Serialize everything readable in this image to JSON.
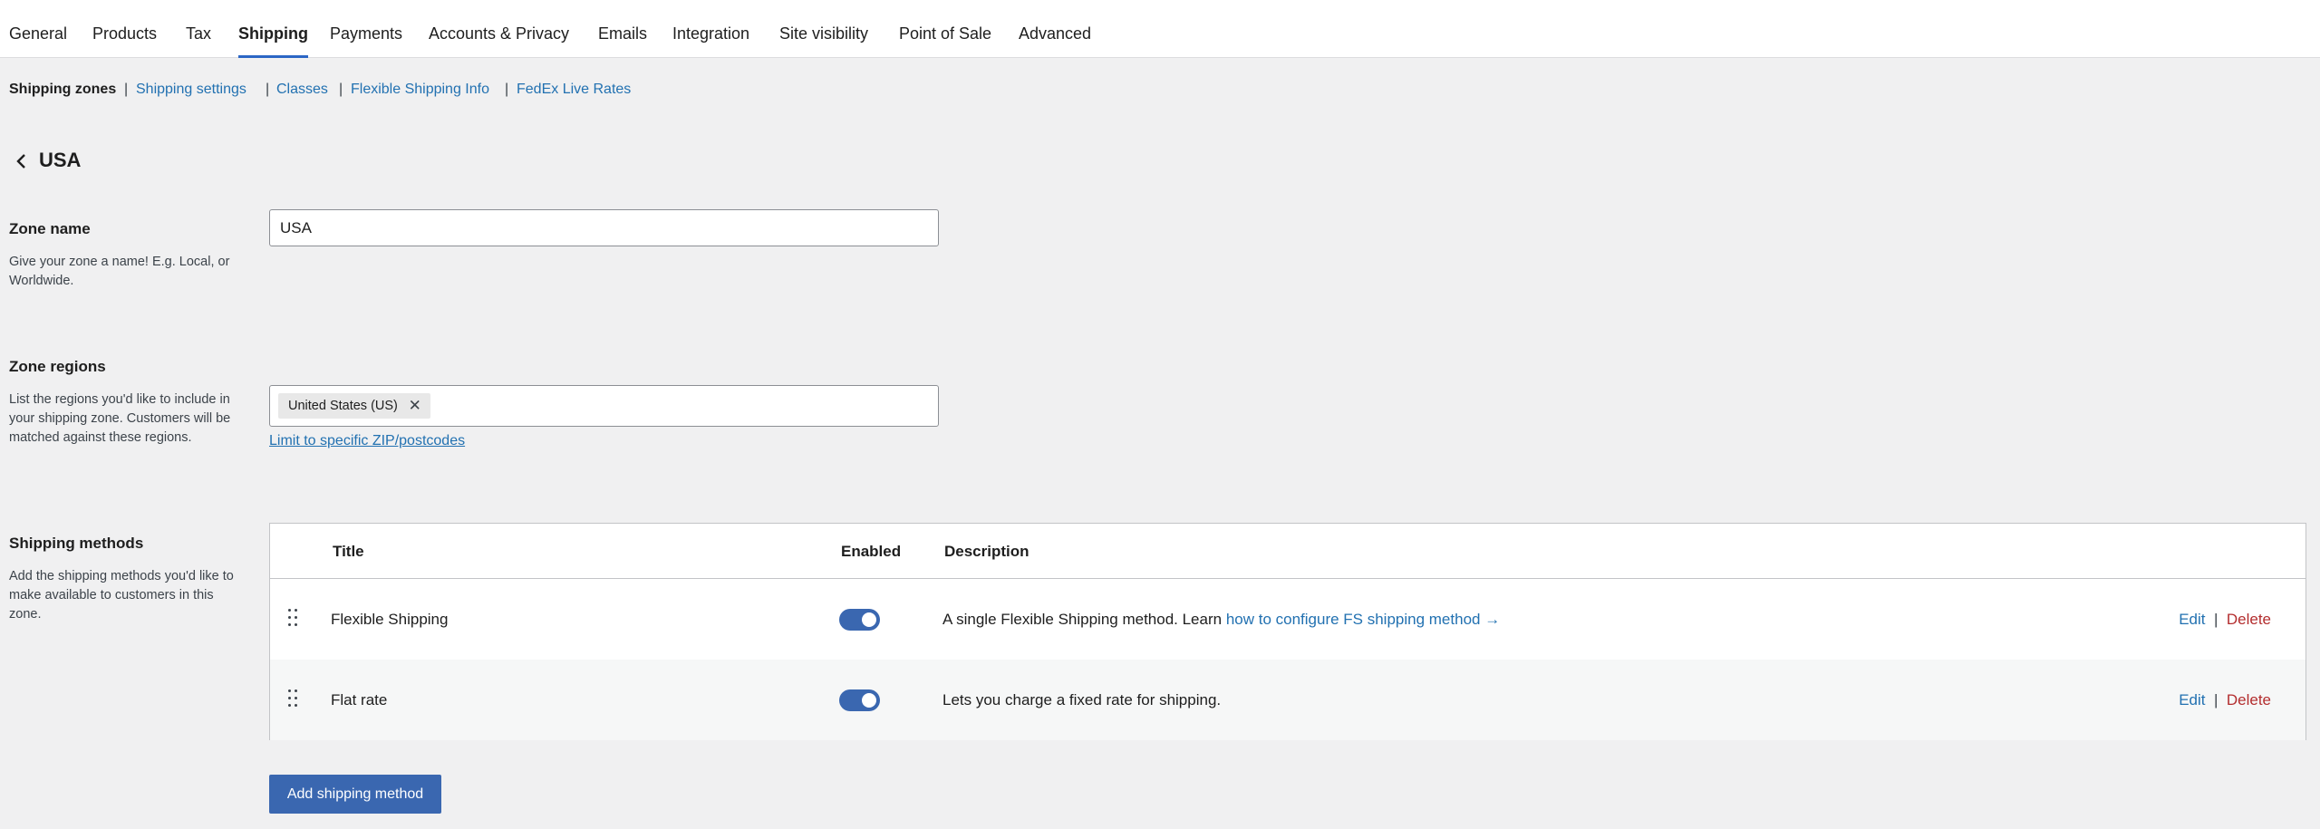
{
  "tabs": [
    {
      "label": "General"
    },
    {
      "label": "Products"
    },
    {
      "label": "Tax"
    },
    {
      "label": "Shipping"
    },
    {
      "label": "Payments"
    },
    {
      "label": "Accounts & Privacy"
    },
    {
      "label": "Emails"
    },
    {
      "label": "Integration"
    },
    {
      "label": "Site visibility"
    },
    {
      "label": "Point of Sale"
    },
    {
      "label": "Advanced"
    }
  ],
  "active_tab": "Shipping",
  "subnav": {
    "current": "Shipping zones",
    "links": [
      "Shipping settings",
      "Classes",
      "Flexible Shipping Info",
      "FedEx Live Rates"
    ],
    "separator": "|"
  },
  "page_title": "USA",
  "zone_name": {
    "title": "Zone name",
    "description": "Give your zone a name! E.g. Local, or Worldwide.",
    "value": "USA"
  },
  "zone_regions": {
    "title": "Zone regions",
    "description": "List the regions you'd like to include in your shipping zone. Customers will be matched against these regions.",
    "chip": "United States (US)",
    "chip_remove": "✕",
    "limit_link": "Limit to specific ZIP/postcodes"
  },
  "shipping_methods": {
    "title": "Shipping methods",
    "description": "Add the shipping methods you'd like to make available to customers in this zone.",
    "columns": {
      "title": "Title",
      "enabled": "Enabled",
      "description": "Description"
    },
    "rows": [
      {
        "title": "Flexible Shipping",
        "enabled": true,
        "description": "A single Flexible Shipping method. Learn ",
        "description_link": "how to configure FS shipping method →",
        "edit": "Edit",
        "delete": "Delete"
      },
      {
        "title": "Flat rate",
        "enabled": true,
        "description": "Lets you charge a fixed rate for shipping.",
        "description_link": "",
        "edit": "Edit",
        "delete": "Delete"
      }
    ],
    "action_separator": "|",
    "add_button": "Add shipping method"
  },
  "colors": {
    "accent": "#3a67b0",
    "link": "#2271b1",
    "delete": "#b32d2e",
    "page_bg": "#f0f0f1"
  }
}
